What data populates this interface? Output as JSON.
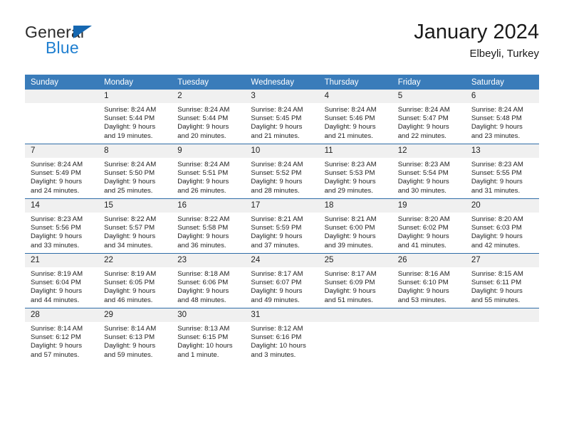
{
  "brand": {
    "name_top": "General",
    "name_bottom": "Blue",
    "accent_color": "#1f7fd0",
    "triangle_color": "#1567b0"
  },
  "header": {
    "title": "January 2024",
    "subtitle": "Elbeyli, Turkey"
  },
  "calendar": {
    "header_bg": "#3a7cba",
    "daynum_bg": "#f0f0f0",
    "week_separator_color": "#2f6da8",
    "weekday_headers": [
      "Sunday",
      "Monday",
      "Tuesday",
      "Wednesday",
      "Thursday",
      "Friday",
      "Saturday"
    ],
    "weeks": [
      [
        {
          "day": "",
          "sunrise": "",
          "sunset": "",
          "daylight1": "",
          "daylight2": "",
          "empty": true
        },
        {
          "day": "1",
          "sunrise": "Sunrise: 8:24 AM",
          "sunset": "Sunset: 5:44 PM",
          "daylight1": "Daylight: 9 hours",
          "daylight2": "and 19 minutes."
        },
        {
          "day": "2",
          "sunrise": "Sunrise: 8:24 AM",
          "sunset": "Sunset: 5:44 PM",
          "daylight1": "Daylight: 9 hours",
          "daylight2": "and 20 minutes."
        },
        {
          "day": "3",
          "sunrise": "Sunrise: 8:24 AM",
          "sunset": "Sunset: 5:45 PM",
          "daylight1": "Daylight: 9 hours",
          "daylight2": "and 21 minutes."
        },
        {
          "day": "4",
          "sunrise": "Sunrise: 8:24 AM",
          "sunset": "Sunset: 5:46 PM",
          "daylight1": "Daylight: 9 hours",
          "daylight2": "and 21 minutes."
        },
        {
          "day": "5",
          "sunrise": "Sunrise: 8:24 AM",
          "sunset": "Sunset: 5:47 PM",
          "daylight1": "Daylight: 9 hours",
          "daylight2": "and 22 minutes."
        },
        {
          "day": "6",
          "sunrise": "Sunrise: 8:24 AM",
          "sunset": "Sunset: 5:48 PM",
          "daylight1": "Daylight: 9 hours",
          "daylight2": "and 23 minutes."
        }
      ],
      [
        {
          "day": "7",
          "sunrise": "Sunrise: 8:24 AM",
          "sunset": "Sunset: 5:49 PM",
          "daylight1": "Daylight: 9 hours",
          "daylight2": "and 24 minutes."
        },
        {
          "day": "8",
          "sunrise": "Sunrise: 8:24 AM",
          "sunset": "Sunset: 5:50 PM",
          "daylight1": "Daylight: 9 hours",
          "daylight2": "and 25 minutes."
        },
        {
          "day": "9",
          "sunrise": "Sunrise: 8:24 AM",
          "sunset": "Sunset: 5:51 PM",
          "daylight1": "Daylight: 9 hours",
          "daylight2": "and 26 minutes."
        },
        {
          "day": "10",
          "sunrise": "Sunrise: 8:24 AM",
          "sunset": "Sunset: 5:52 PM",
          "daylight1": "Daylight: 9 hours",
          "daylight2": "and 28 minutes."
        },
        {
          "day": "11",
          "sunrise": "Sunrise: 8:23 AM",
          "sunset": "Sunset: 5:53 PM",
          "daylight1": "Daylight: 9 hours",
          "daylight2": "and 29 minutes."
        },
        {
          "day": "12",
          "sunrise": "Sunrise: 8:23 AM",
          "sunset": "Sunset: 5:54 PM",
          "daylight1": "Daylight: 9 hours",
          "daylight2": "and 30 minutes."
        },
        {
          "day": "13",
          "sunrise": "Sunrise: 8:23 AM",
          "sunset": "Sunset: 5:55 PM",
          "daylight1": "Daylight: 9 hours",
          "daylight2": "and 31 minutes."
        }
      ],
      [
        {
          "day": "14",
          "sunrise": "Sunrise: 8:23 AM",
          "sunset": "Sunset: 5:56 PM",
          "daylight1": "Daylight: 9 hours",
          "daylight2": "and 33 minutes."
        },
        {
          "day": "15",
          "sunrise": "Sunrise: 8:22 AM",
          "sunset": "Sunset: 5:57 PM",
          "daylight1": "Daylight: 9 hours",
          "daylight2": "and 34 minutes."
        },
        {
          "day": "16",
          "sunrise": "Sunrise: 8:22 AM",
          "sunset": "Sunset: 5:58 PM",
          "daylight1": "Daylight: 9 hours",
          "daylight2": "and 36 minutes."
        },
        {
          "day": "17",
          "sunrise": "Sunrise: 8:21 AM",
          "sunset": "Sunset: 5:59 PM",
          "daylight1": "Daylight: 9 hours",
          "daylight2": "and 37 minutes."
        },
        {
          "day": "18",
          "sunrise": "Sunrise: 8:21 AM",
          "sunset": "Sunset: 6:00 PM",
          "daylight1": "Daylight: 9 hours",
          "daylight2": "and 39 minutes."
        },
        {
          "day": "19",
          "sunrise": "Sunrise: 8:20 AM",
          "sunset": "Sunset: 6:02 PM",
          "daylight1": "Daylight: 9 hours",
          "daylight2": "and 41 minutes."
        },
        {
          "day": "20",
          "sunrise": "Sunrise: 8:20 AM",
          "sunset": "Sunset: 6:03 PM",
          "daylight1": "Daylight: 9 hours",
          "daylight2": "and 42 minutes."
        }
      ],
      [
        {
          "day": "21",
          "sunrise": "Sunrise: 8:19 AM",
          "sunset": "Sunset: 6:04 PM",
          "daylight1": "Daylight: 9 hours",
          "daylight2": "and 44 minutes."
        },
        {
          "day": "22",
          "sunrise": "Sunrise: 8:19 AM",
          "sunset": "Sunset: 6:05 PM",
          "daylight1": "Daylight: 9 hours",
          "daylight2": "and 46 minutes."
        },
        {
          "day": "23",
          "sunrise": "Sunrise: 8:18 AM",
          "sunset": "Sunset: 6:06 PM",
          "daylight1": "Daylight: 9 hours",
          "daylight2": "and 48 minutes."
        },
        {
          "day": "24",
          "sunrise": "Sunrise: 8:17 AM",
          "sunset": "Sunset: 6:07 PM",
          "daylight1": "Daylight: 9 hours",
          "daylight2": "and 49 minutes."
        },
        {
          "day": "25",
          "sunrise": "Sunrise: 8:17 AM",
          "sunset": "Sunset: 6:09 PM",
          "daylight1": "Daylight: 9 hours",
          "daylight2": "and 51 minutes."
        },
        {
          "day": "26",
          "sunrise": "Sunrise: 8:16 AM",
          "sunset": "Sunset: 6:10 PM",
          "daylight1": "Daylight: 9 hours",
          "daylight2": "and 53 minutes."
        },
        {
          "day": "27",
          "sunrise": "Sunrise: 8:15 AM",
          "sunset": "Sunset: 6:11 PM",
          "daylight1": "Daylight: 9 hours",
          "daylight2": "and 55 minutes."
        }
      ],
      [
        {
          "day": "28",
          "sunrise": "Sunrise: 8:14 AM",
          "sunset": "Sunset: 6:12 PM",
          "daylight1": "Daylight: 9 hours",
          "daylight2": "and 57 minutes."
        },
        {
          "day": "29",
          "sunrise": "Sunrise: 8:14 AM",
          "sunset": "Sunset: 6:13 PM",
          "daylight1": "Daylight: 9 hours",
          "daylight2": "and 59 minutes."
        },
        {
          "day": "30",
          "sunrise": "Sunrise: 8:13 AM",
          "sunset": "Sunset: 6:15 PM",
          "daylight1": "Daylight: 10 hours",
          "daylight2": "and 1 minute."
        },
        {
          "day": "31",
          "sunrise": "Sunrise: 8:12 AM",
          "sunset": "Sunset: 6:16 PM",
          "daylight1": "Daylight: 10 hours",
          "daylight2": "and 3 minutes."
        },
        {
          "day": "",
          "sunrise": "",
          "sunset": "",
          "daylight1": "",
          "daylight2": "",
          "empty": true
        },
        {
          "day": "",
          "sunrise": "",
          "sunset": "",
          "daylight1": "",
          "daylight2": "",
          "empty": true
        },
        {
          "day": "",
          "sunrise": "",
          "sunset": "",
          "daylight1": "",
          "daylight2": "",
          "empty": true
        }
      ]
    ]
  }
}
